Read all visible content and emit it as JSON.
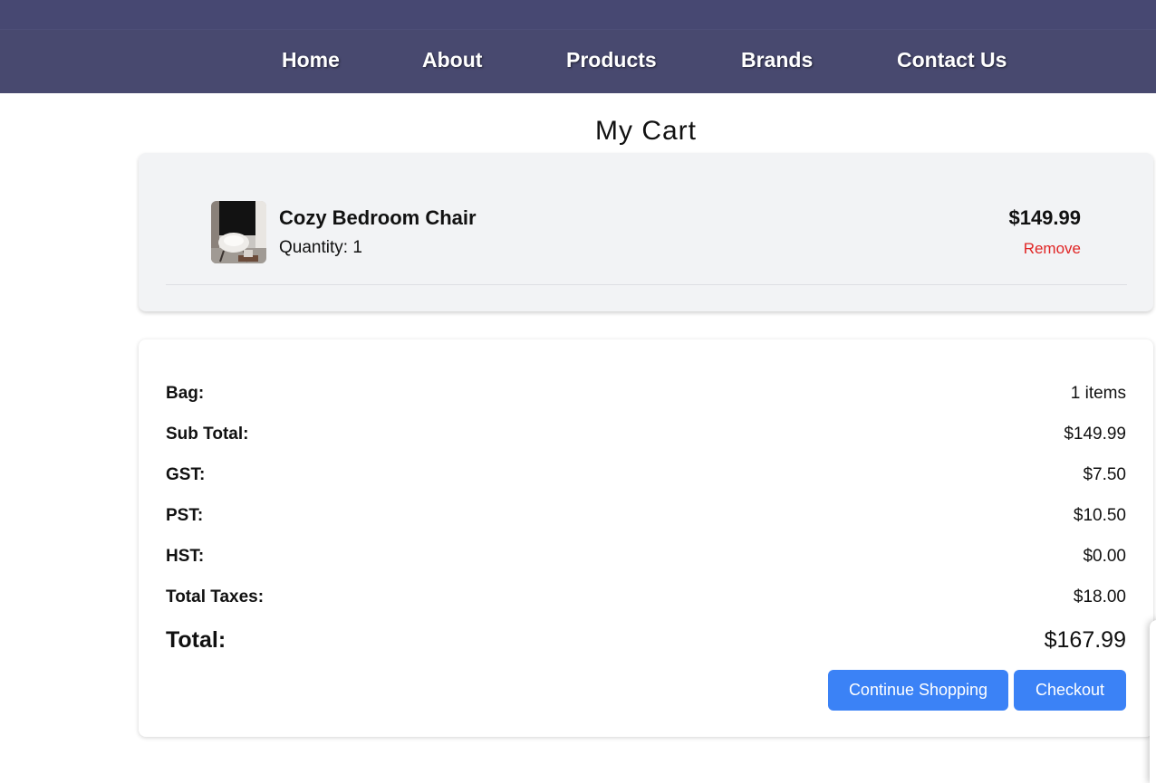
{
  "nav": {
    "items": [
      {
        "label": "Home"
      },
      {
        "label": "About"
      },
      {
        "label": "Products"
      },
      {
        "label": "Brands"
      },
      {
        "label": "Contact Us"
      }
    ]
  },
  "cart": {
    "title": "My Cart",
    "items": [
      {
        "name": "Cozy Bedroom Chair",
        "quantity_text": "Quantity: 1",
        "price": "$149.99",
        "remove_label": "Remove"
      }
    ]
  },
  "summary": {
    "rows": [
      {
        "label": "Bag:",
        "value": "1 items"
      },
      {
        "label": "Sub Total:",
        "value": "$149.99"
      },
      {
        "label": "GST:",
        "value": "$7.50"
      },
      {
        "label": "PST:",
        "value": "$10.50"
      },
      {
        "label": "HST:",
        "value": "$0.00"
      },
      {
        "label": "Total Taxes:",
        "value": "$18.00"
      }
    ],
    "total_label": "Total:",
    "total_value": "$167.99",
    "continue_label": "Continue Shopping",
    "checkout_label": "Checkout"
  },
  "colors": {
    "header_bg": "#48496f",
    "button_bg": "#3b82f6",
    "remove_text": "#e02424",
    "cart_card_bg": "#f2f3f5"
  }
}
